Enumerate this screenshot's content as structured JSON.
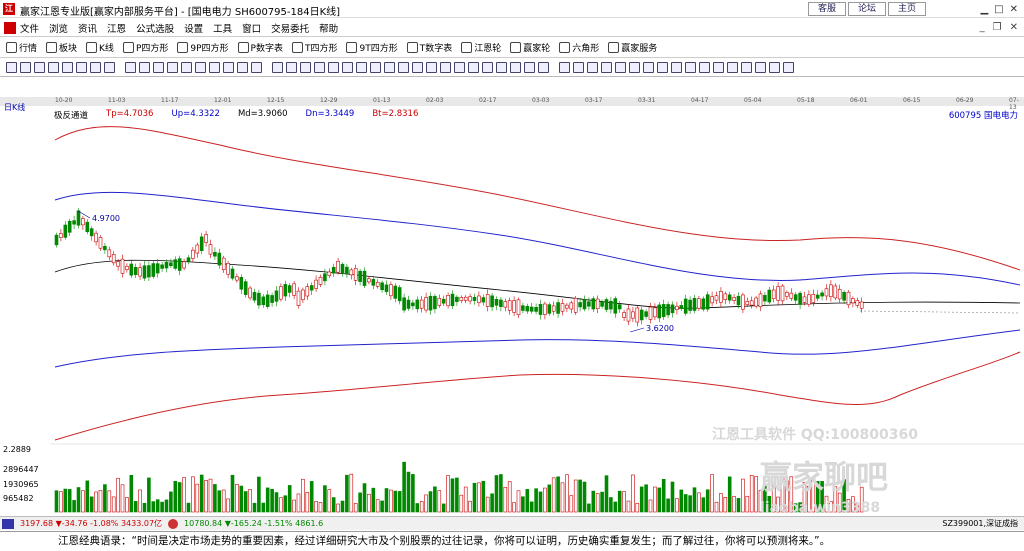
{
  "window": {
    "title": "赢家江恩专业版[赢家内部服务平台] - [国电电力  SH600795-184日K线]",
    "logo": "江",
    "top_links": [
      "客服",
      "论坛",
      "主页"
    ]
  },
  "menu": [
    "文件",
    "浏览",
    "资讯",
    "江恩",
    "公式选股",
    "设置",
    "工具",
    "窗口",
    "交易委托",
    "帮助"
  ],
  "toolbar1": [
    {
      "label": "行情",
      "icon": "grid-icon"
    },
    {
      "label": "板块",
      "icon": "grid-icon"
    },
    {
      "label": "K线",
      "icon": "candle-icon"
    },
    {
      "label": "P四方形",
      "icon": "square-icon"
    },
    {
      "label": "9P四方形",
      "icon": "square-icon"
    },
    {
      "label": "P数字表",
      "icon": "table-icon"
    },
    {
      "label": "T四方形",
      "icon": "square-icon"
    },
    {
      "label": "9T四方形",
      "icon": "square-icon"
    },
    {
      "label": "T数字表",
      "icon": "table-icon"
    },
    {
      "label": "江恩轮",
      "icon": "wheel-icon"
    },
    {
      "label": "赢家轮",
      "icon": "wheel-icon"
    },
    {
      "label": "六角形",
      "icon": "hexagon-icon"
    },
    {
      "label": "赢家服务",
      "icon": "dollar-icon"
    }
  ],
  "chart_header": {
    "period": "日K线",
    "indicator": "极反通道",
    "params": [
      {
        "label": "Tp=4.7036",
        "color": "#cc0000"
      },
      {
        "label": "Up=4.3322",
        "color": "#0000cc"
      },
      {
        "label": "Md=3.9060",
        "color": "#000000"
      },
      {
        "label": "Dn=3.3449",
        "color": "#0000cc"
      },
      {
        "label": "Bt=2.8316",
        "color": "#cc0000"
      }
    ],
    "code": "600795",
    "name": "国电电力"
  },
  "dates": [
    "10-20",
    "11-03",
    "11-17",
    "12-01",
    "12-15",
    "12-29",
    "01-13",
    "02-03",
    "02-17",
    "03-03",
    "03-17",
    "03-31",
    "04-17",
    "05-04",
    "05-18",
    "06-01",
    "06-15",
    "06-29",
    "07-13"
  ],
  "annotations": {
    "high": "4.9700",
    "low": "3.6200"
  },
  "volume": {
    "top": "2.2889",
    "labels": [
      "2896447",
      "1930965",
      "965482"
    ]
  },
  "status": {
    "sh": "3197.68 ▼-34.76 -1.08% 3433.07亿",
    "sz": "10780.84 ▼-165.24 -1.51% 4861.6",
    "right": "SZ399001,深证成指"
  },
  "watermark": {
    "line1": "江恩工具软件  QQ:100800360",
    "line2": "赢家聊吧",
    "line3": "liaoba.win3388"
  },
  "quote": "江恩经典语录：“时间是决定市场走势的重要因素，经过详细研究大市及个别股票的过往记录，你将可以证明，历史确实重复发生；而了解过往，你将可以预测将来。”。"
}
